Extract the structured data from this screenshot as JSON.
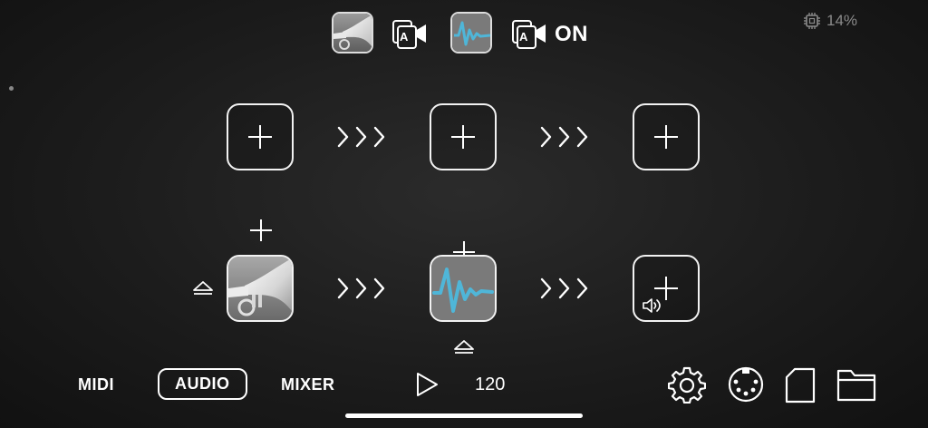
{
  "header": {
    "icons": [
      "trumpet-thumbnail",
      "audio-route-icon",
      "waveform-thumbnail",
      "audio-route-icon"
    ],
    "on_label": "ON",
    "cpu_label": "14%"
  },
  "rows": [
    {
      "slots": [
        "empty",
        "empty",
        "empty"
      ]
    },
    {
      "slots": [
        "trumpet",
        "waveform",
        "output-empty"
      ]
    }
  ],
  "bottom": {
    "tabs": [
      {
        "label": "MIDI",
        "active": false
      },
      {
        "label": "AUDIO",
        "active": true
      },
      {
        "label": "MIXER",
        "active": false
      }
    ],
    "tempo": "120",
    "icons": [
      "play-icon",
      "gear-icon",
      "midi-port-icon",
      "sd-card-icon",
      "folder-icon"
    ]
  },
  "colors": {
    "accent": "#4fb6d8",
    "background": "#1c1c1c",
    "stroke": "#f2f2f2",
    "muted": "#8a8a8a"
  }
}
